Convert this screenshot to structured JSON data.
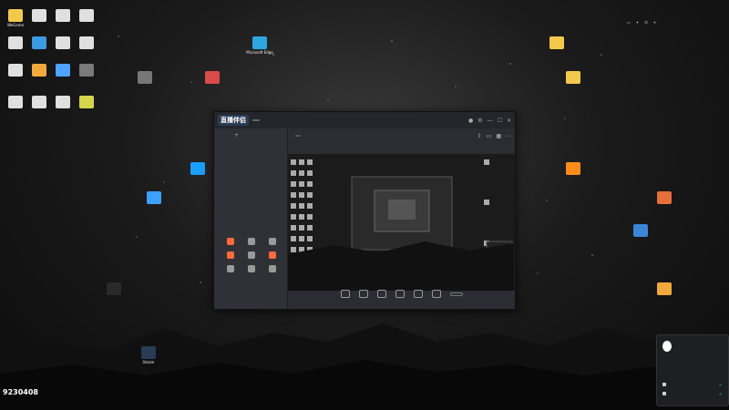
{
  "desktop_left_icons": [
    {
      "label": "WeGame",
      "color": "#f2c94c"
    },
    {
      "label": "",
      "color": "#e0e0e0"
    },
    {
      "label": "",
      "color": "#e0e0e0"
    },
    {
      "label": "",
      "color": "#e0e0e0"
    },
    {
      "label": "",
      "color": "#e0e0e0"
    },
    {
      "label": "",
      "color": "#3b9ae1"
    },
    {
      "label": "",
      "color": "#e0e0e0"
    },
    {
      "label": "",
      "color": "#e0e0e0"
    },
    {
      "label": "",
      "color": "#e0e0e0"
    },
    {
      "label": "",
      "color": "#f2a93b"
    },
    {
      "label": "",
      "color": "#4fa3ff"
    },
    {
      "label": "",
      "color": "#7a7a7a"
    },
    {
      "label": "",
      "color": "#e0e0e0"
    },
    {
      "label": "",
      "color": "#e0e0e0"
    },
    {
      "label": "",
      "color": "#e0e0e0"
    },
    {
      "label": "",
      "color": "#d6d64b"
    }
  ],
  "desktop_other_icons": [
    {
      "label": "Microsoft Edge",
      "color": "#2ea7e0"
    },
    {
      "label": "",
      "color": "#d94a4a"
    },
    {
      "label": "",
      "color": "#777777"
    },
    {
      "label": "",
      "color": "#1a9fff"
    },
    {
      "label": "",
      "color": "#3ba0ff"
    },
    {
      "label": "",
      "color": "#f2c94c"
    },
    {
      "label": "",
      "color": "#f2c94c"
    },
    {
      "label": "",
      "color": "#ff8c1a"
    },
    {
      "label": "",
      "color": "#e66f3a"
    },
    {
      "label": "",
      "color": "#3b86d6"
    },
    {
      "label": "",
      "color": "#f2a93b"
    },
    {
      "label": "",
      "color": "#2a2a2a"
    },
    {
      "label": "Steam",
      "color": "#2a3b55"
    }
  ],
  "app": {
    "logo_text": "直播伴侣",
    "badge": "",
    "tabs": [
      "",
      "",
      ""
    ],
    "scenes": [
      "",
      ""
    ],
    "tools_title": "",
    "tools": [
      {
        "label": "",
        "color": "#ff6a3d"
      },
      {
        "label": "",
        "color": "#9a9a9a"
      },
      {
        "label": "",
        "color": "#9a9a9a"
      },
      {
        "label": "",
        "color": "#ff6a3d"
      },
      {
        "label": "",
        "color": "#9a9a9a"
      },
      {
        "label": "",
        "color": "#ff6a3d"
      },
      {
        "label": "",
        "color": "#9a9a9a"
      },
      {
        "label": "",
        "color": "#9a9a9a"
      },
      {
        "label": "",
        "color": "#9a9a9a"
      }
    ],
    "footer_text": "",
    "stream_title": "",
    "stream_tag": "",
    "live_info": [
      "",
      "",
      ""
    ],
    "controls": [
      "",
      "",
      "",
      "",
      "",
      ""
    ],
    "start_label": ""
  },
  "right_panel": {
    "lines": [
      "",
      "",
      "",
      ""
    ]
  },
  "notification": {
    "title": "",
    "rows": [
      "",
      ""
    ]
  },
  "watermark": {
    "text": "",
    "number": "9230408"
  }
}
